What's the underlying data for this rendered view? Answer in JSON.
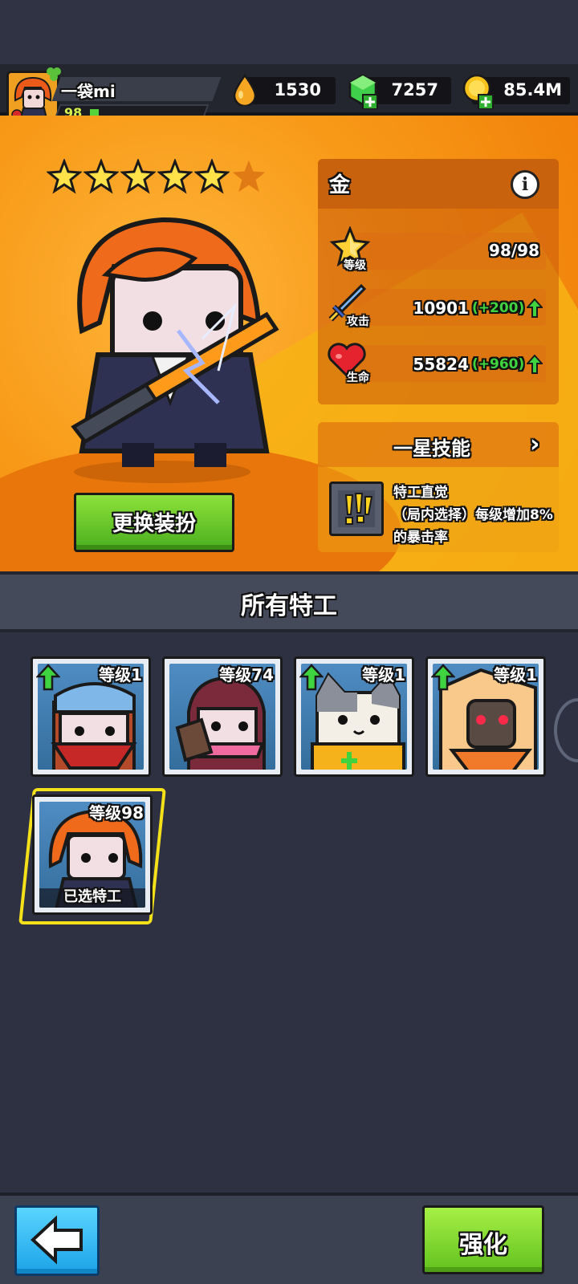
{
  "player": {
    "name": "一袋mi",
    "level": "98",
    "xp_fraction": 0.06
  },
  "resources": [
    {
      "name": "oil-drop",
      "value": "1530"
    },
    {
      "name": "green-gem",
      "value": "7257"
    },
    {
      "name": "gold-coin",
      "value": "85.4M"
    }
  ],
  "hero": {
    "stars_filled": 5,
    "stars_total": 6,
    "rank": "金",
    "stats": {
      "level_label": "等级",
      "level_value": "98/98",
      "attack_label": "攻击",
      "attack_value": "10901",
      "attack_bonus": "(+200)",
      "hp_label": "生命",
      "hp_value": "55824",
      "hp_bonus": "(+960)"
    },
    "skill": {
      "title": "一星技能",
      "name": "特工直觉",
      "desc": "（局内选择）每级增加8%的暴击率"
    },
    "outfit_button": "更换装扮"
  },
  "section_title": "所有特工",
  "agents": [
    {
      "level": "等级1",
      "upgrade_available": true
    },
    {
      "level": "等级74",
      "upgrade_available": false
    },
    {
      "level": "等级1",
      "upgrade_available": true
    },
    {
      "level": "等级1",
      "upgrade_available": true
    },
    {
      "level": "等级98",
      "upgrade_available": false,
      "selected": true,
      "selected_label": "已选特工"
    }
  ],
  "buttons": {
    "upgrade": "强化"
  },
  "colors": {
    "accent_orange": "#f89a18",
    "button_green": "#62c11d",
    "button_blue": "#1ca3e8",
    "selected_yellow": "#f5e11a"
  }
}
